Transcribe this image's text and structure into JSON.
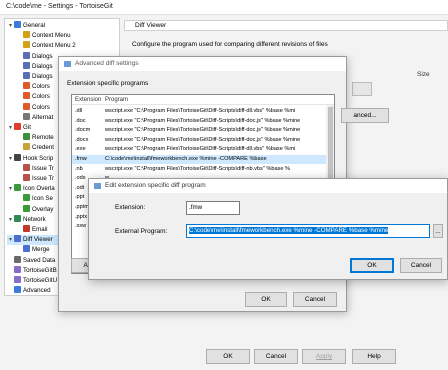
{
  "window": {
    "title": "C:\\code\\me - Settings - TortoiseGit"
  },
  "tree": [
    {
      "label": "General",
      "level": 0,
      "twisty": "▾",
      "icon_color": "#3b7ddd",
      "icon": "wrench-icon"
    },
    {
      "label": "Context Menu",
      "level": 1,
      "twisty": "",
      "icon_color": "#d4a017",
      "icon": "menu-icon"
    },
    {
      "label": "Context Menu 2",
      "level": 1,
      "twisty": "",
      "icon_color": "#d4a017",
      "icon": "menu-icon"
    },
    {
      "label": "Dialogs",
      "level": 1,
      "twisty": "",
      "icon_color": "#5b6fb5",
      "icon": "dialog-icon"
    },
    {
      "label": "Dialogs",
      "level": 1,
      "twisty": "",
      "icon_color": "#5b6fb5",
      "icon": "dialog-icon"
    },
    {
      "label": "Dialogs",
      "level": 1,
      "twisty": "",
      "icon_color": "#5b6fb5",
      "icon": "dialog-icon"
    },
    {
      "label": "Colors",
      "level": 1,
      "twisty": "",
      "icon_color": "#e05a2b",
      "icon": "colors-icon"
    },
    {
      "label": "Colors",
      "level": 1,
      "twisty": "",
      "icon_color": "#e05a2b",
      "icon": "colors-icon"
    },
    {
      "label": "Colors",
      "level": 1,
      "twisty": "",
      "icon_color": "#e05a2b",
      "icon": "colors-icon"
    },
    {
      "label": "Alternat",
      "level": 1,
      "twisty": "",
      "icon_color": "#777777",
      "icon": "alternative-icon"
    },
    {
      "label": "Git",
      "level": 0,
      "twisty": "▾",
      "icon_color": "#e0402b",
      "icon": "git-icon"
    },
    {
      "label": "Remote",
      "level": 1,
      "twisty": "",
      "icon_color": "#3c8f3c",
      "icon": "remote-icon"
    },
    {
      "label": "Credent",
      "level": 1,
      "twisty": "",
      "icon_color": "#c8a13a",
      "icon": "key-icon"
    },
    {
      "label": "Hook Scrip",
      "level": 0,
      "twisty": "▾",
      "icon_color": "#444444",
      "icon": "hook-icon"
    },
    {
      "label": "Issue Tr",
      "level": 1,
      "twisty": "",
      "icon_color": "#b5524a",
      "icon": "bug-icon"
    },
    {
      "label": "Issue Tr",
      "level": 1,
      "twisty": "",
      "icon_color": "#b5524a",
      "icon": "bug-icon"
    },
    {
      "label": "Icon Overla",
      "level": 0,
      "twisty": "▾",
      "icon_color": "#3a9a3a",
      "icon": "overlay-icon"
    },
    {
      "label": "Icon Se",
      "level": 1,
      "twisty": "",
      "icon_color": "#3a9a3a",
      "icon": "overlay-icon"
    },
    {
      "label": "Overlay",
      "level": 1,
      "twisty": "",
      "icon_color": "#3a9a3a",
      "icon": "overlay-icon"
    },
    {
      "label": "Network",
      "level": 0,
      "twisty": "▾",
      "icon_color": "#2e8b57",
      "icon": "network-icon"
    },
    {
      "label": "Email",
      "level": 1,
      "twisty": "",
      "icon_color": "#c0392b",
      "icon": "email-icon"
    },
    {
      "label": "Diff Viewer",
      "level": 0,
      "twisty": "▾",
      "icon_color": "#4a6fd0",
      "icon": "diff-icon",
      "selected": true
    },
    {
      "label": "Merge",
      "level": 1,
      "twisty": "",
      "icon_color": "#4a6fd0",
      "icon": "merge-icon"
    },
    {
      "label": "Saved Data",
      "level": 0,
      "twisty": "",
      "icon_color": "#6a6a6a",
      "icon": "saved-data-icon"
    },
    {
      "label": "TortoiseGitB",
      "level": 0,
      "twisty": "",
      "icon_color": "#8a6cc9",
      "icon": "tortoise-icon"
    },
    {
      "label": "TortoiseGitU",
      "level": 0,
      "twisty": "",
      "icon_color": "#8a6cc9",
      "icon": "tortoise-icon"
    },
    {
      "label": "Advanced",
      "level": 0,
      "twisty": "",
      "icon_color": "#3b7ddd",
      "icon": "wrench-icon"
    }
  ],
  "pane": {
    "header": "Diff Viewer",
    "description": "Configure the program used for comparing different revisions of files",
    "size_label": "Size"
  },
  "main_buttons": {
    "ok": "OK",
    "cancel": "Cancel",
    "apply": "Apply",
    "help": "Help"
  },
  "advanced_dialog": {
    "title": "Advanced diff settings",
    "section_label": "Extension specific programs",
    "columns": {
      "extension": "Extension",
      "program": "Program"
    },
    "rows": [
      {
        "ext": ".dll",
        "program": "wscript.exe \"C:\\Program Files\\TortoiseGit\\Diff-Scripts\\diff-dll.vbs\" %base %mi"
      },
      {
        "ext": ".doc",
        "program": "wscript.exe \"C:\\Program Files\\TortoiseGit\\Diff-Scripts\\diff-doc.js\" %base %mine"
      },
      {
        "ext": ".docm",
        "program": "wscript.exe \"C:\\Program Files\\TortoiseGit\\Diff-Scripts\\diff-doc.js\" %base %mine"
      },
      {
        "ext": ".docx",
        "program": "wscript.exe \"C:\\Program Files\\TortoiseGit\\Diff-Scripts\\diff-doc.js\" %base %mine"
      },
      {
        "ext": ".exe",
        "program": "wscript.exe \"C:\\Program Files\\TortoiseGit\\Diff-Scripts\\diff-dll.vbs\" %base %mi"
      },
      {
        "ext": ".fmw",
        "program": "C:\\code\\me\\install\\fmeworkbench.exe %mine -COMPARE %base",
        "selected": true
      },
      {
        "ext": ".nb",
        "program": "wscript.exe \"C:\\Program Files\\TortoiseGit\\Diff-Scripts\\diff-nb.vbs\" %base %"
      },
      {
        "ext": ".ods",
        "program": "w"
      },
      {
        "ext": ".odt",
        "program": "w"
      },
      {
        "ext": ".ppt",
        "program": "w"
      },
      {
        "ext": ".pptm",
        "program": "w"
      },
      {
        "ext": ".pptx",
        "program": "w"
      },
      {
        "ext": ".sxw",
        "program": "w"
      }
    ],
    "add_button": "Add...",
    "hidden_button": "anced...",
    "ok": "OK",
    "cancel": "Cancel"
  },
  "edit_dialog": {
    "title": "Edit extension specific diff program",
    "extension_label": "Extension:",
    "extension_value": ".fmw",
    "program_label": "External Program:",
    "program_value": "C:\\code\\me\\install\\fmeworkbench.exe %mine -COMPARE %base %mine",
    "browse": "...",
    "ok": "OK",
    "cancel": "Cancel"
  }
}
